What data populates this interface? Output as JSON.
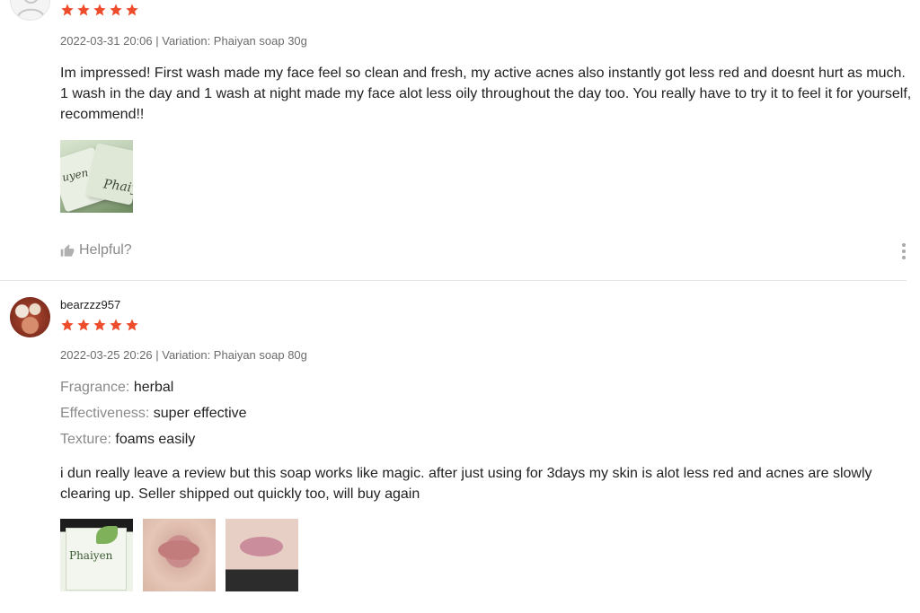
{
  "colors": {
    "star": "#ee4d2d",
    "text": "#222222",
    "muted": "#8a8a8a",
    "meta": "#6b6b6b",
    "divider": "#e5e5e5"
  },
  "reviews": [
    {
      "username": "",
      "rating": 5,
      "meta": "2022-03-31 20:06 | Variation: Phaiyan soap 30g",
      "comment": "Im impressed! First wash made my face feel so clean and fresh, my active acnes also instantly got less red and doesnt hurt as much. 1 wash in the day and 1 wash at night made my face alot less oily throughout the day too. You really have to try it to feel it for yourself, recommend!!",
      "images": [
        "product-photo"
      ],
      "helpful_label": "Helpful?",
      "icons": {
        "avatar": "default-avatar-icon",
        "helpful": "thumbs-up-icon",
        "more": "more-options-icon"
      }
    },
    {
      "username": "bearzzz957",
      "rating": 5,
      "meta": "2022-03-25 20:26 | Variation: Phaiyan soap 80g",
      "attributes": [
        {
          "label": "Fragrance:",
          "value": "herbal"
        },
        {
          "label": "Effectiveness:",
          "value": "super effective"
        },
        {
          "label": "Texture:",
          "value": "foams easily"
        }
      ],
      "comment": "i dun really leave a review but this soap works like magic. after just using for 3days my skin is alot less red and acnes are slowly clearing up. Seller shipped out quickly too, will buy again",
      "images": [
        "product-photo",
        "lips-before-photo",
        "lips-after-photo"
      ]
    }
  ],
  "image_text": {
    "review1_thumb": [
      "uyen",
      "Phaiy"
    ],
    "review2_thumb": [
      "Phaiyen"
    ]
  }
}
